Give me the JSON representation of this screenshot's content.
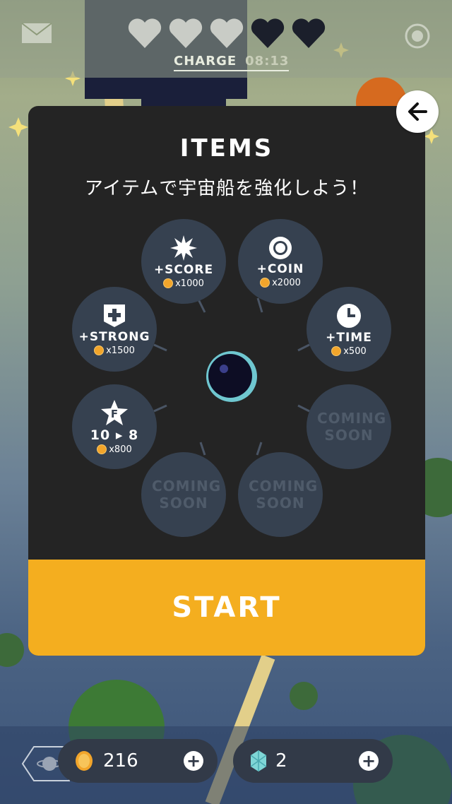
{
  "hud": {
    "charge_label": "CHARGE",
    "charge_time": "08:13",
    "hearts_full": 3,
    "hearts_total": 5
  },
  "panel": {
    "title": "ITEMS",
    "subtitle": "アイテムで宇宙船を強化しよう！",
    "items": [
      {
        "name": "+SCORE",
        "price": "x1000",
        "icon": "burst-icon"
      },
      {
        "name": "+COIN",
        "price": "x2000",
        "icon": "coin-ring-icon"
      },
      {
        "name": "+STRONG",
        "price": "x1500",
        "icon": "shield-plus-icon"
      },
      {
        "name": "+TIME",
        "price": "x500",
        "icon": "clock-icon"
      },
      {
        "name": "10 ▸ 8",
        "price": "x800",
        "icon": "star-f-icon",
        "badge": "F"
      },
      {
        "name": "COMING SOON"
      },
      {
        "name": "COMING SOON"
      },
      {
        "name": "COMING SOON"
      }
    ],
    "start_label": "START"
  },
  "bottom": {
    "coins": "216",
    "gems": "2"
  },
  "colors": {
    "panel_bg": "#242424",
    "item_bg": "#364150",
    "start_bg": "#f4ae1f",
    "coin": "#f2a52b",
    "gem": "#7fd6d6"
  }
}
